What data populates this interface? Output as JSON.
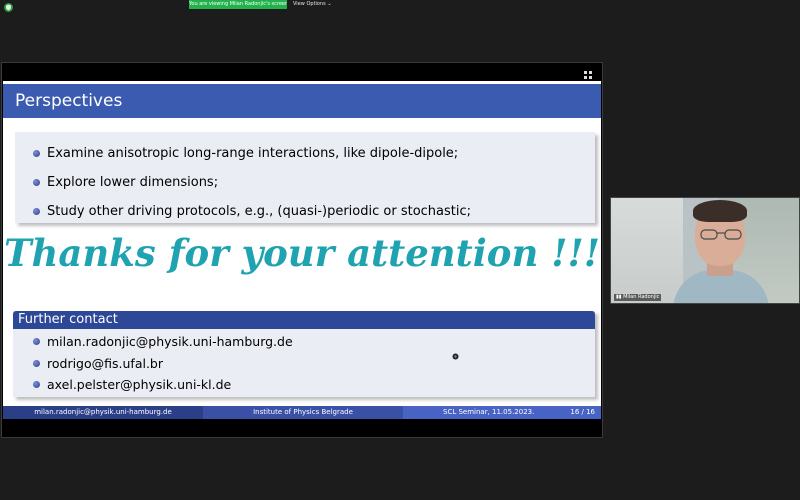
{
  "topbar": {
    "viewing_text": "You are viewing Milan Radonjic's screen",
    "view_options_label": "View Options ⌄"
  },
  "slide": {
    "header_title": "Perspectives",
    "perspectives": [
      "Examine anisotropic long-range interactions, like dipole-dipole;",
      "Explore lower dimensions;",
      "Study other driving protocols, e.g., (quasi-)periodic or stochastic;"
    ],
    "thanks_text": "Thanks for your attention !!!",
    "contact_title": "Further contact",
    "contacts": [
      "milan.radonjic@physik.uni-hamburg.de",
      "rodrigo@fis.ufal.br",
      "axel.pelster@physik.uni-kl.de"
    ],
    "footer": {
      "email": "milan.radonjic@physik.uni-hamburg.de",
      "institute": "Institute of Physics Belgrade",
      "event": "SCL Seminar, 11.05.2023.",
      "page": "16 / 16"
    }
  },
  "video": {
    "participant_name": "Milan Radonjic"
  },
  "colors": {
    "header_blue": "#3b5bb0",
    "thanks_teal": "#1fa3b0",
    "badge_green": "#22b14c"
  },
  "icons": [
    "security-shield-icon",
    "fullscreen-icon",
    "signal-icon",
    "cursor-icon"
  ]
}
